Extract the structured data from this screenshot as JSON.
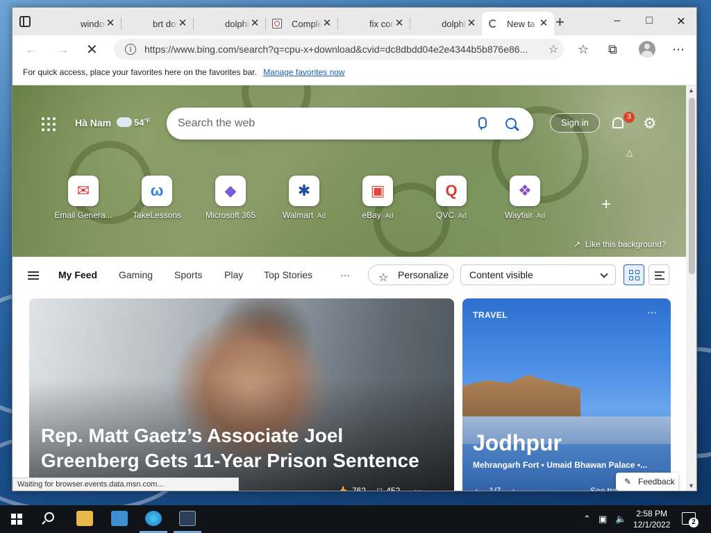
{
  "browser": {
    "tabs": [
      {
        "title": "window",
        "icon": "search-icon"
      },
      {
        "title": "brt dov",
        "icon": "search-icon"
      },
      {
        "title": "dolphin",
        "icon": "search-icon"
      },
      {
        "title": "Comple",
        "icon": "document-icon"
      },
      {
        "title": "fix corr",
        "icon": "search-icon"
      },
      {
        "title": "dolphin",
        "icon": "search-icon"
      },
      {
        "title": "New ta",
        "icon": "loading-icon",
        "active": true
      }
    ],
    "url": "https://www.bing.com/search?q=cpu-x+download&cvid=dc8dbdd04e2e4344b5b876e86...",
    "favorites_bar": {
      "text": "For quick access, place your favorites here on the favorites bar.",
      "link": "Manage favorites now"
    },
    "status_text": "Waiting for browser.events.data.msn.com..."
  },
  "hero": {
    "location": "Hà Nam",
    "temperature": "54",
    "temp_unit": "°F",
    "search_placeholder": "Search the web",
    "signin": "Sign in",
    "notification_count": "3",
    "like_background": "Like this background?",
    "tiles": [
      {
        "label": "Email Genera...",
        "ad": ""
      },
      {
        "label": "TakeLessons",
        "ad": ""
      },
      {
        "label": "Microsoft 365",
        "ad": ""
      },
      {
        "label": "Walmart",
        "ad": "· Ad"
      },
      {
        "label": "eBay",
        "ad": "· Ad"
      },
      {
        "label": "QVC",
        "ad": "· Ad"
      },
      {
        "label": "Wayfair",
        "ad": "· Ad"
      }
    ]
  },
  "feed": {
    "tabs": [
      "My Feed",
      "Gaming",
      "Sports",
      "Play",
      "Top Stories"
    ],
    "more": "···",
    "personalize": "Personalize",
    "content_select": "Content visible"
  },
  "cards": {
    "main": {
      "headline": "Rep. Matt Gaetz’s Associate Joel Greenberg Gets 11-Year Prison Sentence",
      "reactions": "762",
      "comments": "452"
    },
    "travel": {
      "category": "TRAVEL",
      "place": "Jodhpur",
      "subtitle": "Mehrangarh Fort • Umaid Bhawan Palace •...",
      "pager": "1/7",
      "see": "See tra"
    },
    "feedback": "Feedback"
  },
  "taskbar": {
    "time": "2:58 PM",
    "date": "12/1/2022",
    "notifications": "2"
  }
}
